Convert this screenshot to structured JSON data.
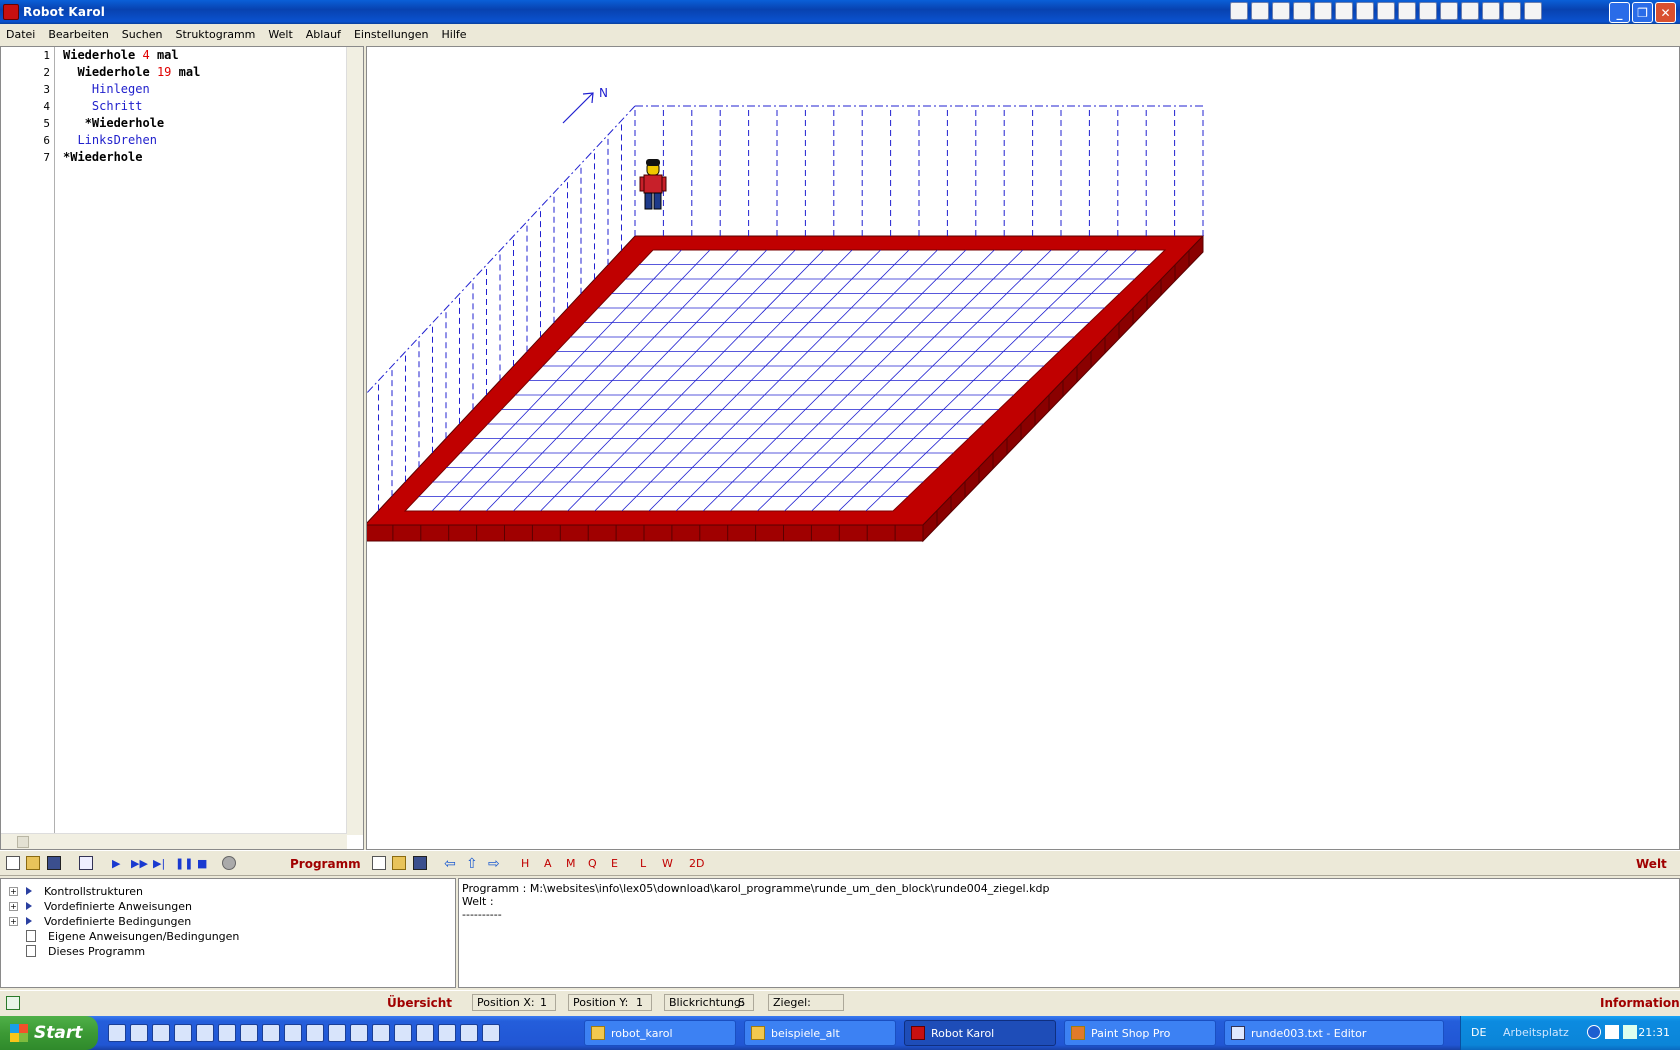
{
  "window": {
    "title": "Robot Karol"
  },
  "menu": [
    "Datei",
    "Bearbeiten",
    "Suchen",
    "Struktogramm",
    "Welt",
    "Ablauf",
    "Einstellungen",
    "Hilfe"
  ],
  "editor": {
    "line_numbers": [
      "1",
      "2",
      "3",
      "4",
      "5",
      "6",
      "7"
    ],
    "lines": [
      {
        "indent": "",
        "kw": "Wiederhole ",
        "num": "4",
        "kw2": " mal",
        "cmd": ""
      },
      {
        "indent": "  ",
        "kw": "Wiederhole ",
        "num": "19",
        "kw2": " mal",
        "cmd": ""
      },
      {
        "indent": "    ",
        "kw": "",
        "num": "",
        "kw2": "",
        "cmd": "Hinlegen"
      },
      {
        "indent": "    ",
        "kw": "",
        "num": "",
        "kw2": "",
        "cmd": "Schritt"
      },
      {
        "indent": "   ",
        "kw": "*Wiederhole",
        "num": "",
        "kw2": "",
        "cmd": ""
      },
      {
        "indent": "  ",
        "kw": "",
        "num": "",
        "kw2": "",
        "cmd": "LinksDrehen"
      },
      {
        "indent": "",
        "kw": "*Wiederhole",
        "num": "",
        "kw2": "",
        "cmd": ""
      }
    ]
  },
  "world": {
    "compass_label": "N",
    "grid_cols": 20,
    "grid_rows": 20,
    "wall_color": "#c00000",
    "grid_color": "#2020d0"
  },
  "toolbar": {
    "program_label": "Programm",
    "world_letters": [
      "H",
      "A",
      "M",
      "Q",
      "E",
      "L",
      "W",
      "2D"
    ],
    "world_label": "Welt"
  },
  "tree": {
    "items": [
      {
        "label": "Kontrollstrukturen",
        "expandable": true
      },
      {
        "label": "Vordefinierte Anweisungen",
        "expandable": true
      },
      {
        "label": "Vordefinierte Bedingungen",
        "expandable": true
      },
      {
        "label": "Eigene Anweisungen/Bedingungen",
        "expandable": false
      },
      {
        "label": "Dieses Programm",
        "expandable": false
      }
    ]
  },
  "info": {
    "lines": [
      "Programm : M:\\websites\\info\\lex05\\download\\karol_programme\\runde_um_den_block\\runde004_ziegel.kdp",
      "Welt :",
      "----------"
    ]
  },
  "status": {
    "overview_label": "Übersicht",
    "pos_x_label": "Position X:",
    "pos_x": "1",
    "pos_y_label": "Position Y:",
    "pos_y": "1",
    "dir_label": "Blickrichtung:",
    "dir": "S",
    "brick_label": "Ziegel:",
    "information_label": "Information"
  },
  "taskbar": {
    "start_label": "Start",
    "tasks": [
      "robot_karol",
      "beispiele_alt",
      "Robot Karol",
      "Paint Shop Pro",
      "runde003.txt - Editor"
    ],
    "active_task": 2,
    "lang": "DE",
    "workplace": "Arbeitsplatz",
    "clock": "21:31"
  }
}
